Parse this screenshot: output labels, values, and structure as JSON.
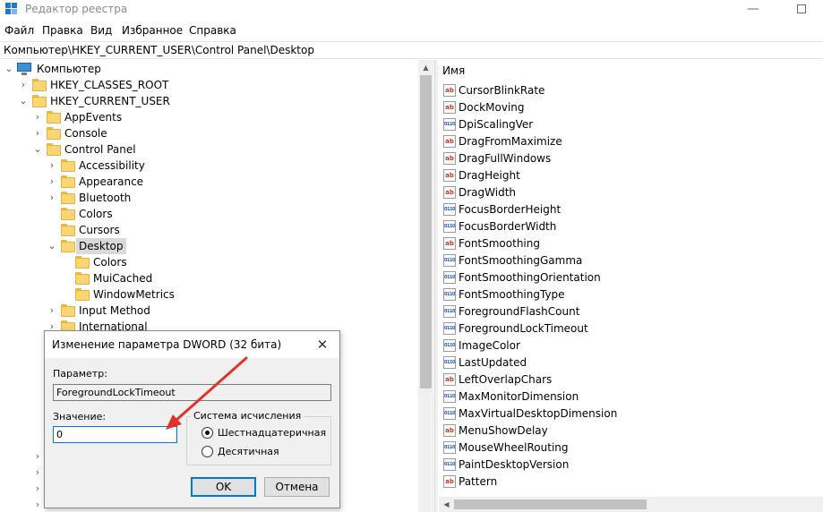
{
  "window": {
    "title": "Редактор реестра",
    "minimize_glyph": "—"
  },
  "menu": [
    "Файл",
    "Правка",
    "Вид",
    "Избранное",
    "Справка"
  ],
  "address": "Компьютер\\HKEY_CURRENT_USER\\Control Panel\\Desktop",
  "tree": {
    "root": "Компьютер",
    "items": [
      {
        "label": "HKEY_CLASSES_ROOT",
        "chevron": "›"
      },
      {
        "label": "HKEY_CURRENT_USER",
        "chevron": "⌄"
      },
      {
        "label": "AppEvents",
        "chevron": "›"
      },
      {
        "label": "Console",
        "chevron": "›"
      },
      {
        "label": "Control Panel",
        "chevron": "⌄"
      },
      {
        "label": "Accessibility",
        "chevron": "›"
      },
      {
        "label": "Appearance",
        "chevron": "›"
      },
      {
        "label": "Bluetooth",
        "chevron": "›"
      },
      {
        "label": "Colors",
        "chevron": ""
      },
      {
        "label": "Cursors",
        "chevron": ""
      },
      {
        "label": "Desktop",
        "chevron": "⌄",
        "selected": true
      },
      {
        "label": "Colors",
        "chevron": ""
      },
      {
        "label": "MuiCached",
        "chevron": ""
      },
      {
        "label": "WindowMetrics",
        "chevron": ""
      },
      {
        "label": "Input Method",
        "chevron": "›"
      },
      {
        "label": "International",
        "chevron": "›"
      }
    ]
  },
  "values": {
    "header": "Имя",
    "items": [
      {
        "name": "CursorBlinkRate",
        "type": "string",
        "icon": "ab"
      },
      {
        "name": "DockMoving",
        "type": "string",
        "icon": "ab"
      },
      {
        "name": "DpiScalingVer",
        "type": "dword",
        "icon": "0110"
      },
      {
        "name": "DragFromMaximize",
        "type": "string",
        "icon": "ab"
      },
      {
        "name": "DragFullWindows",
        "type": "string",
        "icon": "ab"
      },
      {
        "name": "DragHeight",
        "type": "string",
        "icon": "ab"
      },
      {
        "name": "DragWidth",
        "type": "string",
        "icon": "ab"
      },
      {
        "name": "FocusBorderHeight",
        "type": "dword",
        "icon": "0110"
      },
      {
        "name": "FocusBorderWidth",
        "type": "dword",
        "icon": "0110"
      },
      {
        "name": "FontSmoothing",
        "type": "string",
        "icon": "ab"
      },
      {
        "name": "FontSmoothingGamma",
        "type": "dword",
        "icon": "0110"
      },
      {
        "name": "FontSmoothingOrientation",
        "type": "dword",
        "icon": "0110"
      },
      {
        "name": "FontSmoothingType",
        "type": "dword",
        "icon": "0110"
      },
      {
        "name": "ForegroundFlashCount",
        "type": "dword",
        "icon": "0110"
      },
      {
        "name": "ForegroundLockTimeout",
        "type": "dword",
        "icon": "0110"
      },
      {
        "name": "ImageColor",
        "type": "dword",
        "icon": "0110"
      },
      {
        "name": "LastUpdated",
        "type": "dword",
        "icon": "0110"
      },
      {
        "name": "LeftOverlapChars",
        "type": "string",
        "icon": "ab"
      },
      {
        "name": "MaxMonitorDimension",
        "type": "dword",
        "icon": "0110"
      },
      {
        "name": "MaxVirtualDesktopDimension",
        "type": "dword",
        "icon": "0110"
      },
      {
        "name": "MenuShowDelay",
        "type": "string",
        "icon": "ab"
      },
      {
        "name": "MouseWheelRouting",
        "type": "dword",
        "icon": "0110"
      },
      {
        "name": "PaintDesktopVersion",
        "type": "dword",
        "icon": "0110"
      },
      {
        "name": "Pattern",
        "type": "string",
        "icon": "ab"
      }
    ]
  },
  "dialog": {
    "title": "Изменение параметра DWORD (32 бита)",
    "close_glyph": "✕",
    "param_label": "Параметр:",
    "param_value": "ForegroundLockTimeout",
    "value_label": "Значение:",
    "value": "0",
    "base_group": "Система исчисления",
    "hex_label": "Шестнадцатеричная",
    "dec_label": "Десятичная",
    "selected_base": "hex",
    "ok": "OK",
    "cancel": "Отмена"
  },
  "colors": {
    "accent": "#0078d7",
    "annotation_arrow": "#e0332a",
    "folder": "#f9d675"
  }
}
